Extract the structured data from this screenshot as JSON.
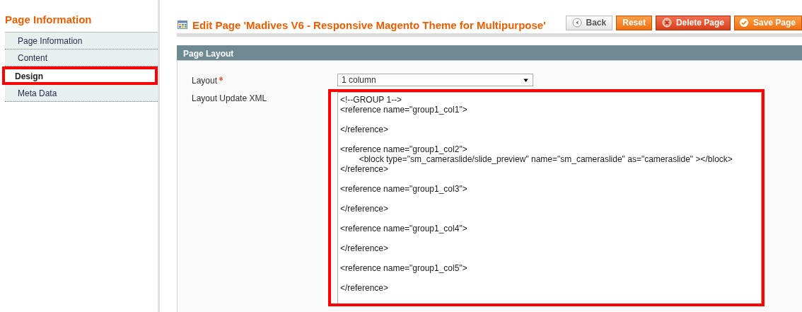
{
  "sidebar": {
    "title": "Page Information",
    "items": [
      {
        "label": "Page Information",
        "selected": false,
        "highlighted": false
      },
      {
        "label": "Content",
        "selected": false,
        "highlighted": false
      },
      {
        "label": "Design",
        "selected": true,
        "highlighted": true
      },
      {
        "label": "Meta Data",
        "selected": false,
        "highlighted": false
      }
    ]
  },
  "header": {
    "title": "Edit Page 'Madives V6 - Responsive Magento Theme for Multipurpose'",
    "buttons": [
      {
        "label": "Back",
        "kind": "back"
      },
      {
        "label": "Reset",
        "kind": "reset"
      },
      {
        "label": "Delete Page",
        "kind": "delete"
      },
      {
        "label": "Save Page",
        "kind": "save"
      }
    ]
  },
  "section": {
    "title": "Page Layout",
    "fields": [
      {
        "kind": "select",
        "label": "Layout",
        "required": true,
        "value": "1 column"
      },
      {
        "kind": "textarea",
        "label": "Layout Update XML",
        "highlighted": true,
        "value": "<!--GROUP 1-->\n<reference name=\"group1_col1\">\n\n</reference>\n\n<reference name=\"group1_col2\">\n        <block type=\"sm_cameraslide/slide_preview\" name=\"sm_cameraslide\" as=\"cameraslide\" ></block>\n</reference>\n\n<reference name=\"group1_col3\">\n\n</reference>\n\n<reference name=\"group1_col4\">\n\n</reference>\n\n<reference name=\"group1_col5\">\n\n</reference>"
      }
    ]
  }
}
